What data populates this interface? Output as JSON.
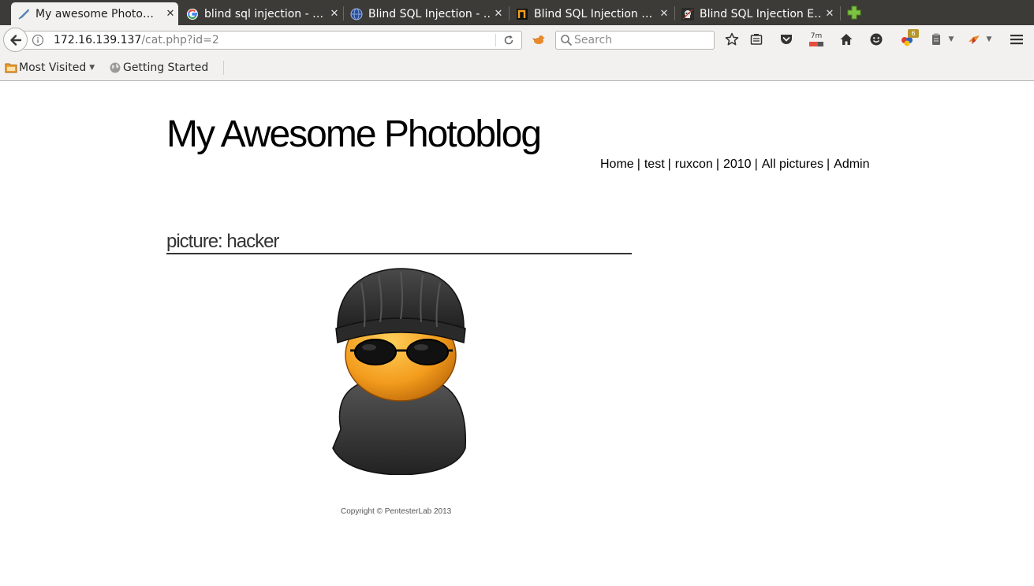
{
  "browser": {
    "tabs": [
      {
        "title": "My awesome Photo…",
        "favicon": "feather-icon"
      },
      {
        "title": "blind sql injection - …",
        "favicon": "google-icon"
      },
      {
        "title": "Blind SQL Injection - …",
        "favicon": "globe-icon"
      },
      {
        "title": "Blind SQL Injection …",
        "favicon": "n-logo-icon"
      },
      {
        "title": "Blind SQL Injection E…",
        "favicon": "pirate-icon"
      }
    ],
    "close_glyph": "✕",
    "url_host": "172.16.139.137",
    "url_path": "/cat.php?id=2",
    "search_placeholder": "Search",
    "timer_badge": "7m",
    "notification_count": "6"
  },
  "bookmarks": {
    "most_visited": "Most Visited",
    "getting_started": "Getting Started"
  },
  "blog": {
    "title": "My Awesome Photoblog",
    "menu": [
      "Home",
      "test",
      "ruxcon",
      "2010",
      "All pictures",
      "Admin"
    ],
    "menu_separator": "|",
    "picture_heading": "picture: hacker",
    "copyright": "Copyright © PentesterLab 2013"
  },
  "colors": {
    "chrome_dark": "#3c3b37",
    "chrome_light": "#f2f1f0",
    "face_orange": "#f39c1d"
  }
}
